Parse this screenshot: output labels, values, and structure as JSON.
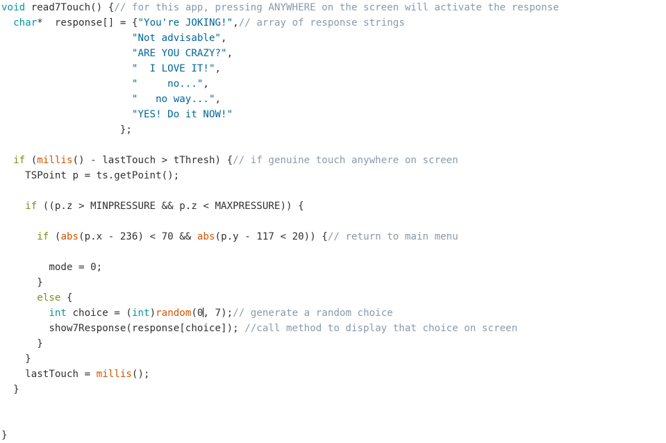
{
  "editor": {
    "name": "code-editor",
    "language": "arduino-c",
    "background_color": "#ffffff",
    "caret": {
      "visible": true,
      "line_index": 17,
      "after_text": "random(0"
    },
    "colors": {
      "keyword": "#00979c",
      "control": "#7f8c1a",
      "function": "#d35400",
      "string": "#006699",
      "comment": "#8a99a8",
      "plain": "#303030"
    }
  },
  "code": {
    "lines": [
      {
        "indent": "",
        "tokens": [
          {
            "t": "kw",
            "v": "void"
          },
          {
            "t": "plain",
            "v": " read7Touch() {"
          },
          {
            "t": "cmt",
            "v": "// for this app, pressing ANYWHERE on the screen will activate the response"
          }
        ]
      },
      {
        "indent": "  ",
        "tokens": [
          {
            "t": "kw",
            "v": "char"
          },
          {
            "t": "plain",
            "v": "*  response[] = {"
          },
          {
            "t": "str",
            "v": "\"You're JOKING!\""
          },
          {
            "t": "plain",
            "v": ","
          },
          {
            "t": "cmt",
            "v": "// array of response strings"
          }
        ]
      },
      {
        "indent": "                      ",
        "tokens": [
          {
            "t": "str",
            "v": "\"Not advisable\""
          },
          {
            "t": "plain",
            "v": ","
          }
        ]
      },
      {
        "indent": "                      ",
        "tokens": [
          {
            "t": "str",
            "v": "\"ARE YOU CRAZY?\""
          },
          {
            "t": "plain",
            "v": ","
          }
        ]
      },
      {
        "indent": "                      ",
        "tokens": [
          {
            "t": "str",
            "v": "\"  I LOVE IT!\""
          },
          {
            "t": "plain",
            "v": ","
          }
        ]
      },
      {
        "indent": "                      ",
        "tokens": [
          {
            "t": "str",
            "v": "\"     no...\""
          },
          {
            "t": "plain",
            "v": ","
          }
        ]
      },
      {
        "indent": "                      ",
        "tokens": [
          {
            "t": "str",
            "v": "\"   no way...\""
          },
          {
            "t": "plain",
            "v": ","
          }
        ]
      },
      {
        "indent": "                      ",
        "tokens": [
          {
            "t": "str",
            "v": "\"YES! Do it NOW!\""
          }
        ]
      },
      {
        "indent": "                    ",
        "tokens": [
          {
            "t": "plain",
            "v": "};"
          }
        ]
      },
      {
        "indent": "",
        "tokens": [],
        "blank": true
      },
      {
        "indent": "  ",
        "tokens": [
          {
            "t": "ctrl",
            "v": "if"
          },
          {
            "t": "plain",
            "v": " ("
          },
          {
            "t": "fn",
            "v": "millis"
          },
          {
            "t": "plain",
            "v": "() - lastTouch > tThresh) {"
          },
          {
            "t": "cmt",
            "v": "// if genuine touch anywhere on screen"
          }
        ]
      },
      {
        "indent": "    ",
        "tokens": [
          {
            "t": "plain",
            "v": "TSPoint p = ts.getPoint();"
          }
        ]
      },
      {
        "indent": "",
        "tokens": [],
        "blank": true
      },
      {
        "indent": "    ",
        "tokens": [
          {
            "t": "ctrl",
            "v": "if"
          },
          {
            "t": "plain",
            "v": " ((p.z > MINPRESSURE && p.z < MAXPRESSURE)) {"
          }
        ]
      },
      {
        "indent": "",
        "tokens": [],
        "blank": true
      },
      {
        "indent": "      ",
        "tokens": [
          {
            "t": "ctrl",
            "v": "if"
          },
          {
            "t": "plain",
            "v": " ("
          },
          {
            "t": "fn",
            "v": "abs"
          },
          {
            "t": "plain",
            "v": "(p.x - 236) < 70 && "
          },
          {
            "t": "fn",
            "v": "abs"
          },
          {
            "t": "plain",
            "v": "(p.y - 117 < 20)) {"
          },
          {
            "t": "cmt",
            "v": "// return to main menu"
          }
        ]
      },
      {
        "indent": "",
        "tokens": [],
        "blank": true
      },
      {
        "indent": "        ",
        "tokens": [
          {
            "t": "plain",
            "v": "mode = 0;"
          }
        ]
      },
      {
        "indent": "      ",
        "tokens": [
          {
            "t": "plain",
            "v": "}"
          }
        ]
      },
      {
        "indent": "      ",
        "tokens": [
          {
            "t": "ctrl",
            "v": "else"
          },
          {
            "t": "plain",
            "v": " {"
          }
        ]
      },
      {
        "indent": "        ",
        "tokens": [
          {
            "t": "kw",
            "v": "int"
          },
          {
            "t": "plain",
            "v": " choice = ("
          },
          {
            "t": "kw",
            "v": "int"
          },
          {
            "t": "plain",
            "v": ")"
          },
          {
            "t": "fn",
            "v": "random"
          },
          {
            "t": "plain",
            "v": "(0"
          },
          {
            "t": "caret",
            "v": ""
          },
          {
            "t": "plain",
            "v": ", 7);"
          },
          {
            "t": "cmt",
            "v": "// generate a random choice"
          }
        ]
      },
      {
        "indent": "        ",
        "tokens": [
          {
            "t": "plain",
            "v": "show7Response(response[choice]); "
          },
          {
            "t": "cmt",
            "v": "//call method to display that choice on screen"
          }
        ]
      },
      {
        "indent": "      ",
        "tokens": [
          {
            "t": "plain",
            "v": "}"
          }
        ]
      },
      {
        "indent": "    ",
        "tokens": [
          {
            "t": "plain",
            "v": "}"
          }
        ]
      },
      {
        "indent": "    ",
        "tokens": [
          {
            "t": "plain",
            "v": "lastTouch = "
          },
          {
            "t": "fn",
            "v": "millis"
          },
          {
            "t": "plain",
            "v": "();"
          }
        ]
      },
      {
        "indent": "  ",
        "tokens": [
          {
            "t": "plain",
            "v": "}"
          }
        ]
      },
      {
        "indent": "",
        "tokens": [],
        "blank": true
      },
      {
        "indent": "",
        "tokens": [],
        "blank": true
      },
      {
        "indent": "",
        "tokens": [
          {
            "t": "plain",
            "v": "}"
          }
        ]
      }
    ]
  }
}
